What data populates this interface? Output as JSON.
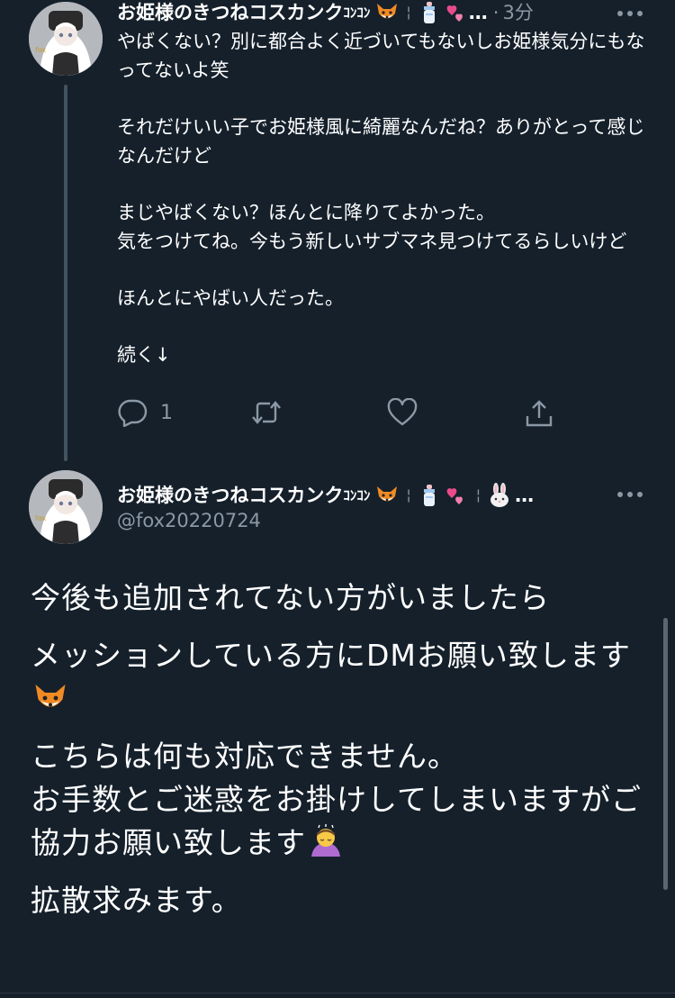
{
  "reply_tweet": {
    "display_name": "お姫様のきつねコスカンク",
    "name_suffix": "ｺﾝｺﾝ",
    "name_truncation": "…",
    "separator": "·",
    "timestamp": "3分",
    "paragraphs": [
      "やばくない？別に都合よく近づいてもないしお姫様気分にもなってないよ笑",
      "それだけいい子でお姫様風に綺麗なんだね？ありがとって感じなんだけど",
      "まじやばくない？ほんとに降りてよかった。\n気をつけてね。今もう新しいサブマネ見つけてるらしいけど",
      "ほんとにやばい人だった。",
      "続く↓"
    ],
    "reply_count": "1"
  },
  "main_tweet": {
    "display_name": "お姫様のきつねコスカンク",
    "name_suffix": "ｺﾝｺﾝ",
    "name_truncation": "…",
    "handle": "@fox20220724",
    "paragraphs": [
      "今後も追加されてない方がいましたら",
      "メッションしている方にDMお願い致します",
      "こちらは何も対応できません。\nお手数とご迷惑をお掛けしてしまいますがご協力お願い致します",
      "拡散求みます。"
    ]
  },
  "icons": [
    "fox-emoji-icon",
    "baby-bottle-icon",
    "two-hearts-icon",
    "rabbit-icon",
    "bowing-person-icon",
    "reply-icon",
    "retweet-icon",
    "like-icon",
    "share-icon",
    "more-icon"
  ],
  "colors": {
    "background": "#15202b",
    "text": "#ffffff",
    "secondary": "#8b98a5",
    "thread_line": "#42535f"
  }
}
